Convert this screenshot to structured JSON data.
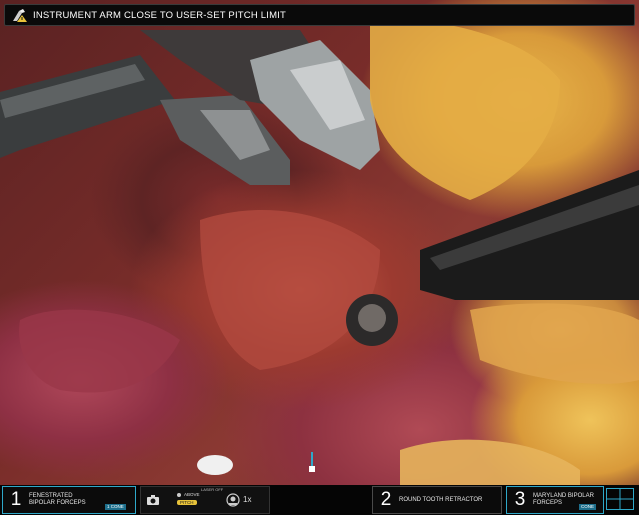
{
  "alert": {
    "icon": "instrument-arm-warning-icon",
    "message": "INSTRUMENT ARM CLOSE TO USER-SET PITCH LIMIT"
  },
  "arms": [
    {
      "number": "1",
      "label_line1": "FENESTRATED",
      "label_line2": "BIPOLAR FORCEPS",
      "energy": "1 CONE"
    },
    {
      "number": "2",
      "label_line1": "ROUND TOOTH RETRACTOR",
      "label_line2": ""
    },
    {
      "number": "3",
      "label_line1": "MARYLAND BIPOLAR",
      "label_line2": "FORCEPS",
      "energy": "CONE"
    }
  ],
  "controls": {
    "laser": "LASER OFF",
    "above": "ABOVE",
    "pitch": "PITCH",
    "magnification": "1x",
    "camera_icon": "camera-icon",
    "zoom_icon": "scope-icon"
  },
  "colors": {
    "accent_cyan": "#2ea8c9",
    "pitch_yellow": "#e8c33a"
  }
}
